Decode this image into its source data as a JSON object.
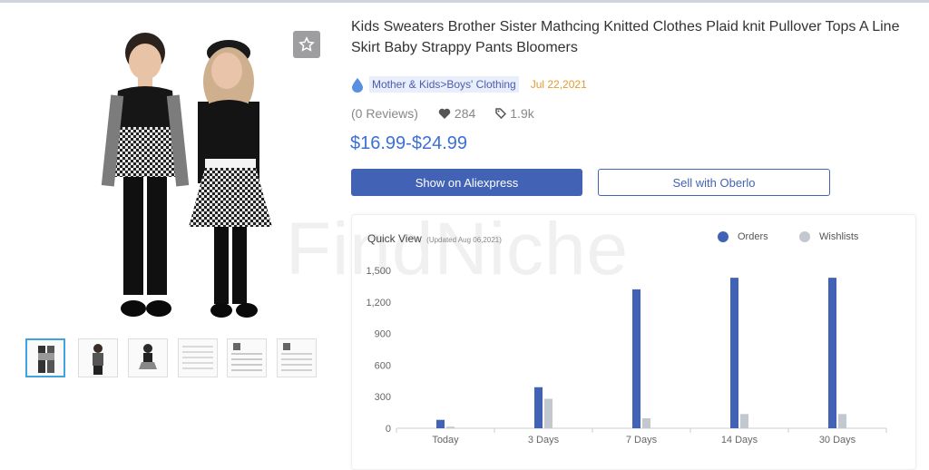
{
  "product": {
    "title": "Kids Sweaters Brother Sister Mathcing Knitted Clothes Plaid knit Pullover Tops A Line Skirt Baby Strappy Pants Bloomers",
    "category": "Mother & Kids>Boys' Clothing",
    "date": "Jul 22,2021",
    "reviews": "(0 Reviews)",
    "likes": "284",
    "sold": "1.9k",
    "price": "$16.99-$24.99",
    "watermark": "FindNiche"
  },
  "actions": {
    "aliexpress_label": "Show on Aliexpress",
    "oberlo_label": "Sell with Oberlo"
  },
  "colors": {
    "accent": "#4263b5",
    "price": "#3b6fd8",
    "date": "#e59b2e",
    "wishlist": "#c3c7d0"
  },
  "quick_view": {
    "title": "Quick View",
    "updated": "(Updated Aug 06,2021)",
    "legend_orders": "Orders",
    "legend_wishlists": "Wishlists"
  },
  "chart_data": {
    "type": "bar",
    "title": "Quick View",
    "categories": [
      "Today",
      "3 Days",
      "7 Days",
      "14 Days",
      "30 Days"
    ],
    "series": [
      {
        "name": "Orders",
        "values": [
          80,
          390,
          1320,
          1430,
          1430
        ]
      },
      {
        "name": "Wishlists",
        "values": [
          15,
          280,
          95,
          135,
          135
        ]
      }
    ],
    "yticks": [
      "0",
      "300",
      "600",
      "900",
      "1,200",
      "1,500"
    ],
    "ylim": [
      0,
      1500
    ]
  }
}
